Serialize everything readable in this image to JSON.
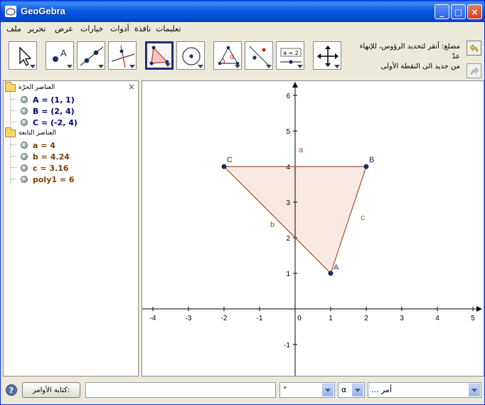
{
  "window": {
    "title": "GeoGebra",
    "min_label": "_",
    "max_label": "□",
    "close_label": "×"
  },
  "menu": [
    {
      "id": "file",
      "label": "ملف"
    },
    {
      "id": "edit",
      "label": "تحرير"
    },
    {
      "id": "view",
      "label": "عرض"
    },
    {
      "id": "options",
      "label": "خيارات"
    },
    {
      "id": "tools",
      "label": "أدوات"
    },
    {
      "id": "window",
      "label": "نافذة"
    },
    {
      "id": "help",
      "label": "تعليمات"
    }
  ],
  "toolbar": {
    "help_line1": "مضلع: أنقر لتحديد الرؤوس، للإنهاء",
    "help_line2": "عدّ",
    "help_line3": "من جديد الى النقطة الأولى",
    "slider_tool_text": "a = 2"
  },
  "algebra": {
    "close_label": "×",
    "free_objects_label": "العناصر الحرّة",
    "dependent_objects_label": "العناصر التابعة",
    "free": [
      {
        "label": "A = (1, 1)",
        "color": "#00007f"
      },
      {
        "label": "B = (2, 4)",
        "color": "#00007f"
      },
      {
        "label": "C = (-2, 4)",
        "color": "#00007f"
      }
    ],
    "dependent": [
      {
        "label": "a = 4",
        "color": "#7f3f00"
      },
      {
        "label": "b = 4.24",
        "color": "#7f3f00"
      },
      {
        "label": "c = 3.16",
        "color": "#7f3f00"
      },
      {
        "label": "poly1 = 6",
        "color": "#7f3f00"
      }
    ]
  },
  "graphics": {
    "x_ticks": [
      "-4",
      "-3",
      "-2",
      "-1",
      "0",
      "1",
      "2",
      "3",
      "4",
      "5"
    ],
    "y_ticks": [
      "-1",
      "1",
      "2",
      "3",
      "4",
      "5",
      "6"
    ],
    "points": [
      {
        "name": "A",
        "x": 1,
        "y": 1
      },
      {
        "name": "B",
        "x": 2,
        "y": 4
      },
      {
        "name": "C",
        "x": -2,
        "y": 4
      }
    ],
    "segment_labels": {
      "a": "a",
      "b": "b",
      "c": "c"
    },
    "point_color": "#1c2a6b",
    "polygon_fill": "#f5e1d8",
    "polygon_stroke": "#a0522d",
    "label_color": "#a0522d"
  },
  "inputbar": {
    "help_icon": "?",
    "input_button_label": "كتابة الأوامر:",
    "input_value": "",
    "degree_value": "°",
    "greek_value": "α",
    "command_value": "أمر ..."
  }
}
